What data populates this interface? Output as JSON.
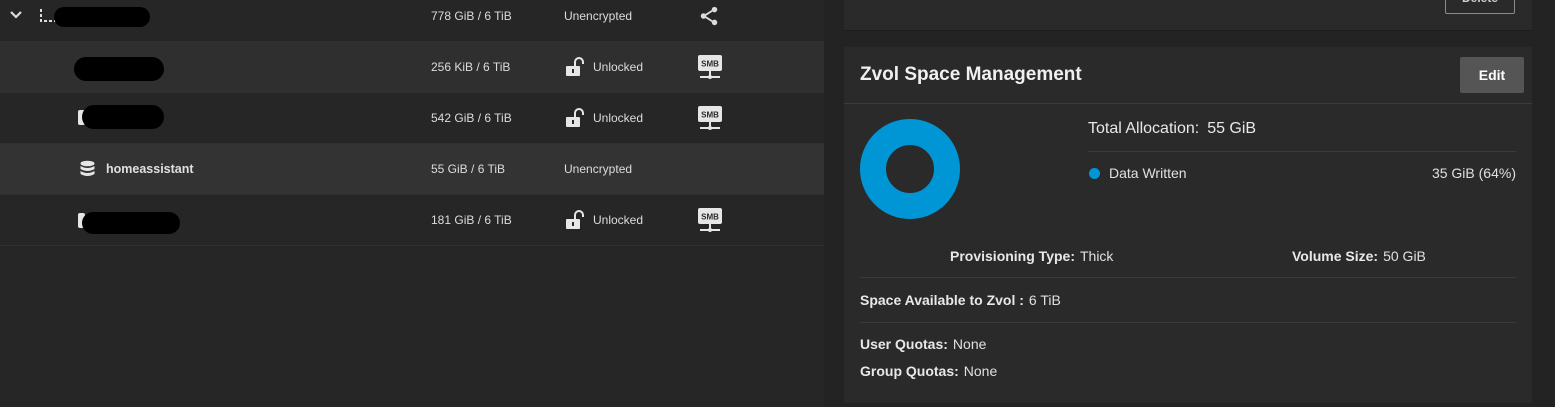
{
  "datasets": [
    {
      "used": "778 GiB / 6 TiB",
      "encryption": "Unencrypted",
      "role": "share-icon"
    },
    {
      "used": "256 KiB / 6 TiB",
      "encryption": "Unlocked",
      "role": "smb-icon"
    },
    {
      "used": "542 GiB / 6 TiB",
      "encryption": "Unlocked",
      "role": "smb-icon"
    },
    {
      "name": "homeassistant",
      "used": "55 GiB / 6 TiB",
      "encryption": "Unencrypted",
      "role": ""
    },
    {
      "used": "181 GiB / 6 TiB",
      "encryption": "Unlocked",
      "role": "smb-icon"
    }
  ],
  "smb_badge": "SMB",
  "top_card": {
    "delete_label": "Delete"
  },
  "zvol": {
    "title": "Zvol Space Management",
    "edit_label": "Edit",
    "total_allocation_label": "Total Allocation:",
    "total_allocation_value": "55 GiB",
    "legend_label": "Data Written",
    "legend_value": "35 GiB (64%)",
    "data_written_fraction": 1.0,
    "provisioning_label": "Provisioning Type:",
    "provisioning_value": "Thick",
    "volume_size_label": "Volume Size:",
    "volume_size_value": "50 GiB",
    "space_available_label": "Space Available to Zvol :",
    "space_available_value": "6 TiB",
    "user_quotas_label": "User Quotas:",
    "user_quotas_value": "None",
    "group_quotas_label": "Group Quotas:",
    "group_quotas_value": "None"
  },
  "colors": {
    "accent": "#0095d5",
    "background": "#232323",
    "card": "#2a2a2a"
  }
}
